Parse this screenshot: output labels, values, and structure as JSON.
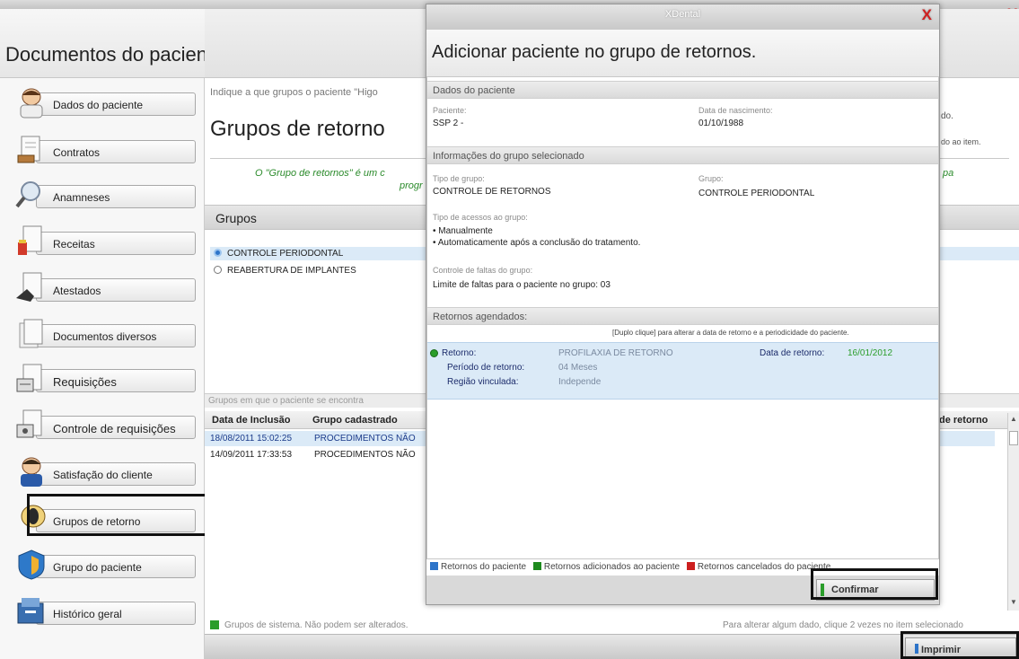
{
  "window": {
    "right_close": "X"
  },
  "left_panel": {
    "title": "Documentos do paciente",
    "items": [
      {
        "label": "Dados do paciente",
        "icon": "doctor-icon"
      },
      {
        "label": "Contratos",
        "icon": "contract-icon"
      },
      {
        "label": "Anamneses",
        "icon": "magnifier-icon"
      },
      {
        "label": "Receitas",
        "icon": "prescription-icon"
      },
      {
        "label": "Atestados",
        "icon": "certificate-icon"
      },
      {
        "label": "Documentos diversos",
        "icon": "documents-icon"
      },
      {
        "label": "Requisições",
        "icon": "requisition-icon"
      },
      {
        "label": "Controle de requisições",
        "icon": "requisition-control-icon"
      },
      {
        "label": "Satisfação do cliente",
        "icon": "satisfaction-icon"
      },
      {
        "label": "Grupos de retorno",
        "icon": "return-groups-icon"
      },
      {
        "label": "Grupo do paciente",
        "icon": "patient-group-icon"
      },
      {
        "label": "Histórico geral",
        "icon": "history-icon"
      }
    ]
  },
  "main": {
    "intro": "Indique a que grupos o paciente \"Higo",
    "title": "Grupos de retorno",
    "desc_line1": "O \"Grupo de retornos\" é um c",
    "desc_line2": "progr",
    "desc_right": "pa",
    "right_text1": "do.",
    "right_text2": "do ao item.",
    "groups_header": "Grupos",
    "groups": [
      {
        "label": "CONTROLE PERIODONTAL",
        "selected": true
      },
      {
        "label": "REABERTURA DE IMPLANTES",
        "selected": false
      }
    ],
    "enrolled_caption": "Grupos em que o paciente se encontra",
    "table": {
      "headers": [
        "Data de Inclusão",
        "Grupo cadastrado"
      ],
      "right_header": "de retorno",
      "rows": [
        {
          "date": "18/08/2011 15:02:25",
          "group": "PROCEDIMENTOS NÃO"
        },
        {
          "date": "14/09/2011 17:33:53",
          "group": "PROCEDIMENTOS NÃO"
        }
      ]
    },
    "footer_legend": "Grupos de sistema. Não podem ser alterados.",
    "footer_hint": "Para alterar algum dado, clique 2 vezes no item selecionado",
    "print_label": "Imprimir",
    "colors": {
      "green": "#2a9d2a",
      "selection": "#dbeaf7"
    }
  },
  "dialog": {
    "window_title": "XDental",
    "close": "X",
    "heading": "Adicionar paciente no grupo de retornos.",
    "patient_section": "Dados do paciente",
    "patient_label": "Paciente:",
    "patient_value": "SSP 2 -",
    "birth_label": "Data de nascimento:",
    "birth_value": "01/10/1988",
    "group_section": "Informações do grupo selecionado",
    "type_label": "Tipo de grupo:",
    "type_value": "CONTROLE DE RETORNOS",
    "group_label": "Grupo:",
    "group_value": "CONTROLE PERIODONTAL",
    "access_label": "Tipo de acessos ao grupo:",
    "access_1": "• Manualmente",
    "access_2": "• Automaticamente após a conclusão do tratamento.",
    "absence_label": "Controle de faltas do grupo:",
    "absence_value": "Limite de faltas para o paciente no grupo: 03",
    "scheduled_section": "Retornos agendados:",
    "scheduled_hint": "[Duplo clique] para alterar a data de retorno e a periodicidade do paciente.",
    "entry": {
      "retorno_label": "Retorno:",
      "retorno_value": "PROFILAXIA DE RETORNO",
      "date_label": "Data de retorno:",
      "date_value": "16/01/2012",
      "period_label": "Período de retorno:",
      "period_value": "04 Meses",
      "region_label": "Região vinculada:",
      "region_value": "Independe"
    },
    "legend": {
      "patient": "Retornos do paciente",
      "added": "Retornos adicionados ao paciente",
      "cancelled": "Retornos cancelados do paciente"
    },
    "legend_colors": {
      "patient": "#2d74c9",
      "added": "#1e8a1e",
      "cancelled": "#cc1f1f"
    },
    "confirm_label": "Confirmar"
  }
}
